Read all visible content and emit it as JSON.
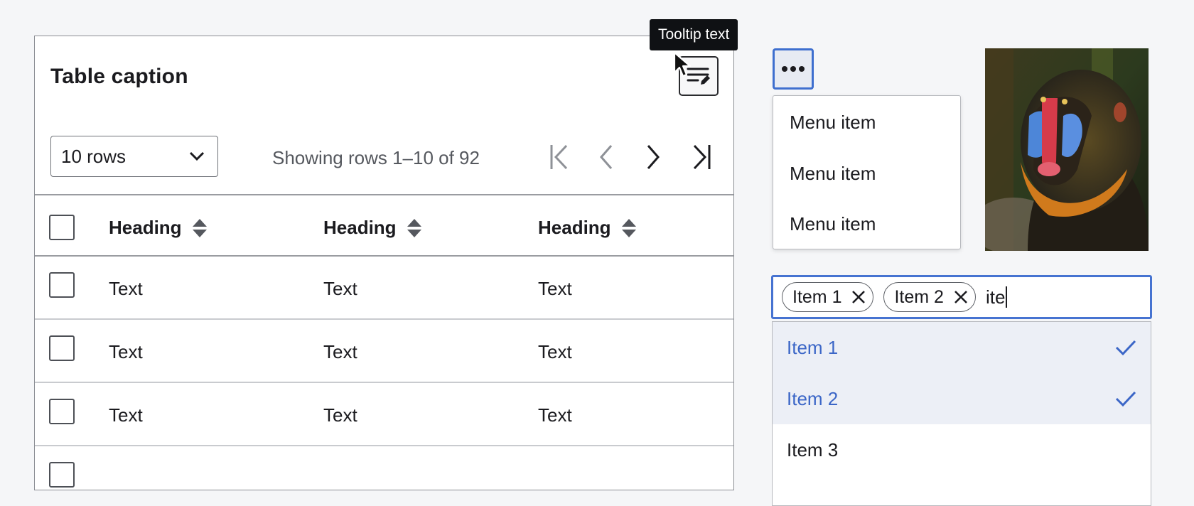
{
  "tooltip": {
    "text": "Tooltip text"
  },
  "table": {
    "caption": "Table caption",
    "rows_select": {
      "value": "10 rows"
    },
    "pagination": {
      "status": "Showing rows 1–10 of 92"
    },
    "headers": [
      "Heading",
      "Heading",
      "Heading"
    ],
    "rows": [
      [
        "Text",
        "Text",
        "Text"
      ],
      [
        "Text",
        "Text",
        "Text"
      ],
      [
        "Text",
        "Text",
        "Text"
      ]
    ]
  },
  "menu": {
    "items": [
      "Menu item",
      "Menu item",
      "Menu item"
    ]
  },
  "multiselect": {
    "chips": [
      "Item 1",
      "Item 2"
    ],
    "input_value": "ite",
    "options": [
      {
        "label": "Item 1",
        "selected": true
      },
      {
        "label": "Item 2",
        "selected": true
      },
      {
        "label": "Item 3",
        "selected": false
      }
    ]
  },
  "colors": {
    "accent": "#3e6fcf",
    "selected_text": "#3b66c7",
    "tooltip_bg": "#0f1114"
  }
}
